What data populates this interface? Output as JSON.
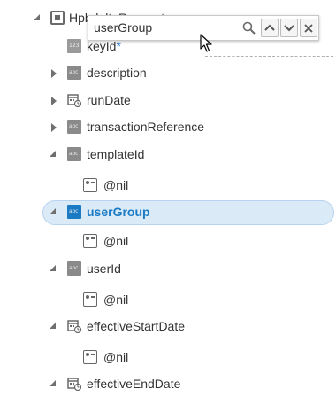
{
  "tree": {
    "root": {
      "label": "HpbdeltaRequest"
    },
    "items": [
      {
        "label": "keyId",
        "required_mark": "*"
      },
      {
        "label": "description"
      },
      {
        "label": "runDate"
      },
      {
        "label": "transactionReference"
      },
      {
        "label": "templateId"
      },
      {
        "label": "@nil"
      },
      {
        "label": "userGroup"
      },
      {
        "label": "@nil"
      },
      {
        "label": "userId"
      },
      {
        "label": "@nil"
      },
      {
        "label": "effectiveStartDate"
      },
      {
        "label": "@nil"
      },
      {
        "label": "effectiveEndDate"
      }
    ]
  },
  "search": {
    "value": "userGroup",
    "icons": {
      "search": "search-icon",
      "prev": "chevron-up-icon",
      "next": "chevron-down-icon",
      "close": "close-icon"
    }
  },
  "colors": {
    "selection_bg": "#dbeaf7",
    "selection_text": "#1a7ac4",
    "required_star": "#2f7fd0"
  }
}
